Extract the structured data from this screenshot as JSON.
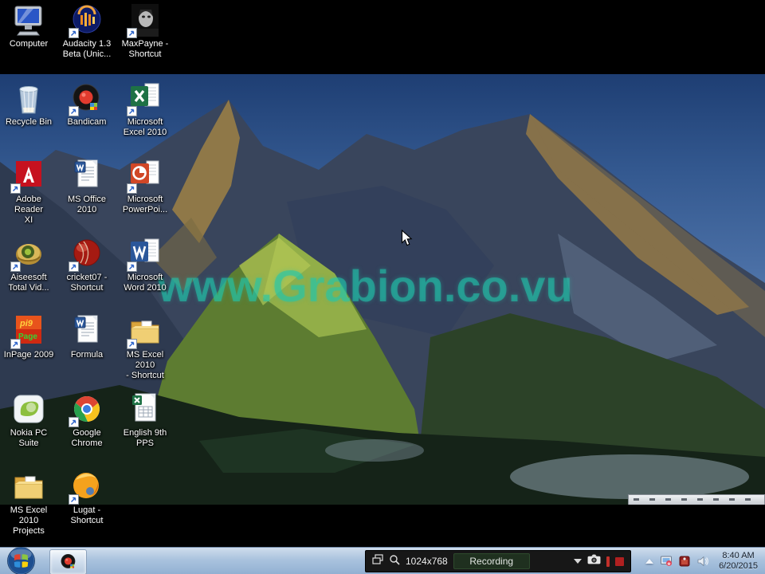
{
  "desktop": {
    "watermark": "www.Grabion.co.vu",
    "icons": [
      {
        "name": "computer",
        "label": "Computer",
        "icon": "computer",
        "col": 0,
        "row": 0,
        "shortcut": false
      },
      {
        "name": "audacity",
        "label": "Audacity 1.3\nBeta (Unic...",
        "icon": "audacity",
        "col": 1,
        "row": 0,
        "shortcut": true
      },
      {
        "name": "maxpayne",
        "label": "MaxPayne -\nShortcut",
        "icon": "maxpayne",
        "col": 2,
        "row": 0,
        "shortcut": true
      },
      {
        "name": "recycle-bin",
        "label": "Recycle Bin",
        "icon": "recycle-bin",
        "col": 0,
        "row": 1,
        "shortcut": false
      },
      {
        "name": "bandicam",
        "label": "Bandicam",
        "icon": "bandicam",
        "col": 1,
        "row": 1,
        "shortcut": true
      },
      {
        "name": "microsoft-excel-2010",
        "label": "Microsoft\nExcel 2010",
        "icon": "excel",
        "col": 2,
        "row": 1,
        "shortcut": true
      },
      {
        "name": "adobe-reader-xi",
        "label": "Adobe Reader\nXI",
        "icon": "adobe-reader",
        "col": 0,
        "row": 2,
        "shortcut": true
      },
      {
        "name": "ms-office-2010",
        "label": "MS Office\n2010",
        "icon": "word-doc",
        "col": 1,
        "row": 2,
        "shortcut": false
      },
      {
        "name": "microsoft-powerpoint",
        "label": "Microsoft\nPowerPoi...",
        "icon": "powerpoint",
        "col": 2,
        "row": 2,
        "shortcut": true
      },
      {
        "name": "aiseesoft-total-video",
        "label": "Aiseesoft\nTotal Vid...",
        "icon": "aiseesoft",
        "col": 0,
        "row": 3,
        "shortcut": true
      },
      {
        "name": "cricket07",
        "label": "cricket07 -\nShortcut",
        "icon": "cricket",
        "col": 1,
        "row": 3,
        "shortcut": true
      },
      {
        "name": "microsoft-word-2010",
        "label": "Microsoft\nWord 2010",
        "icon": "word",
        "col": 2,
        "row": 3,
        "shortcut": true
      },
      {
        "name": "inpage-2009",
        "label": "InPage 2009",
        "icon": "inpage",
        "col": 0,
        "row": 4,
        "shortcut": true
      },
      {
        "name": "formula",
        "label": "Formula",
        "icon": "word-doc",
        "col": 1,
        "row": 4,
        "shortcut": false
      },
      {
        "name": "ms-excel-2010-shortcut",
        "label": "MS Excel 2010\n- Shortcut",
        "icon": "folder",
        "col": 2,
        "row": 4,
        "shortcut": true
      },
      {
        "name": "nokia-pc-suite",
        "label": "Nokia PC\nSuite",
        "icon": "nokia",
        "col": 0,
        "row": 5,
        "shortcut": false
      },
      {
        "name": "google-chrome",
        "label": "Google\nChrome",
        "icon": "chrome",
        "col": 1,
        "row": 5,
        "shortcut": true
      },
      {
        "name": "english-9th-pps",
        "label": "English 9th\nPPS",
        "icon": "excel-doc",
        "col": 2,
        "row": 5,
        "shortcut": false
      },
      {
        "name": "ms-excel-2010-projects",
        "label": "MS Excel 2010\nProjects",
        "icon": "folder",
        "col": 0,
        "row": 6,
        "shortcut": false
      },
      {
        "name": "lugat",
        "label": "Lugat -\nShortcut",
        "icon": "lugat",
        "col": 1,
        "row": 6,
        "shortcut": true
      }
    ]
  },
  "taskbar": {
    "start_button": {
      "icon": "windows-orb-icon"
    },
    "app_buttons": [
      {
        "name": "bandicam",
        "icon": "bandicam-icon"
      }
    ],
    "recorder_bar": {
      "resolution": "1024x768",
      "status_label": "Recording",
      "icons": [
        "target-window-icon",
        "magnifier-icon",
        "dropdown-icon",
        "camera-icon",
        "record-pause-icon",
        "record-stop-icon"
      ]
    },
    "tray": {
      "icons": [
        "bandicam-tray-icon",
        "recorder-tray-icon",
        "volume-icon"
      ],
      "time": "8:40 AM",
      "date": "6/20/2015"
    }
  },
  "colors": {
    "watermark": "#20c7ad",
    "taskbar": "#aac3de",
    "recorder_bar_bg": "#171717",
    "record_red": "#c2302a",
    "sky_top": "#1e3e73",
    "sky_bottom": "#88a9cc"
  }
}
